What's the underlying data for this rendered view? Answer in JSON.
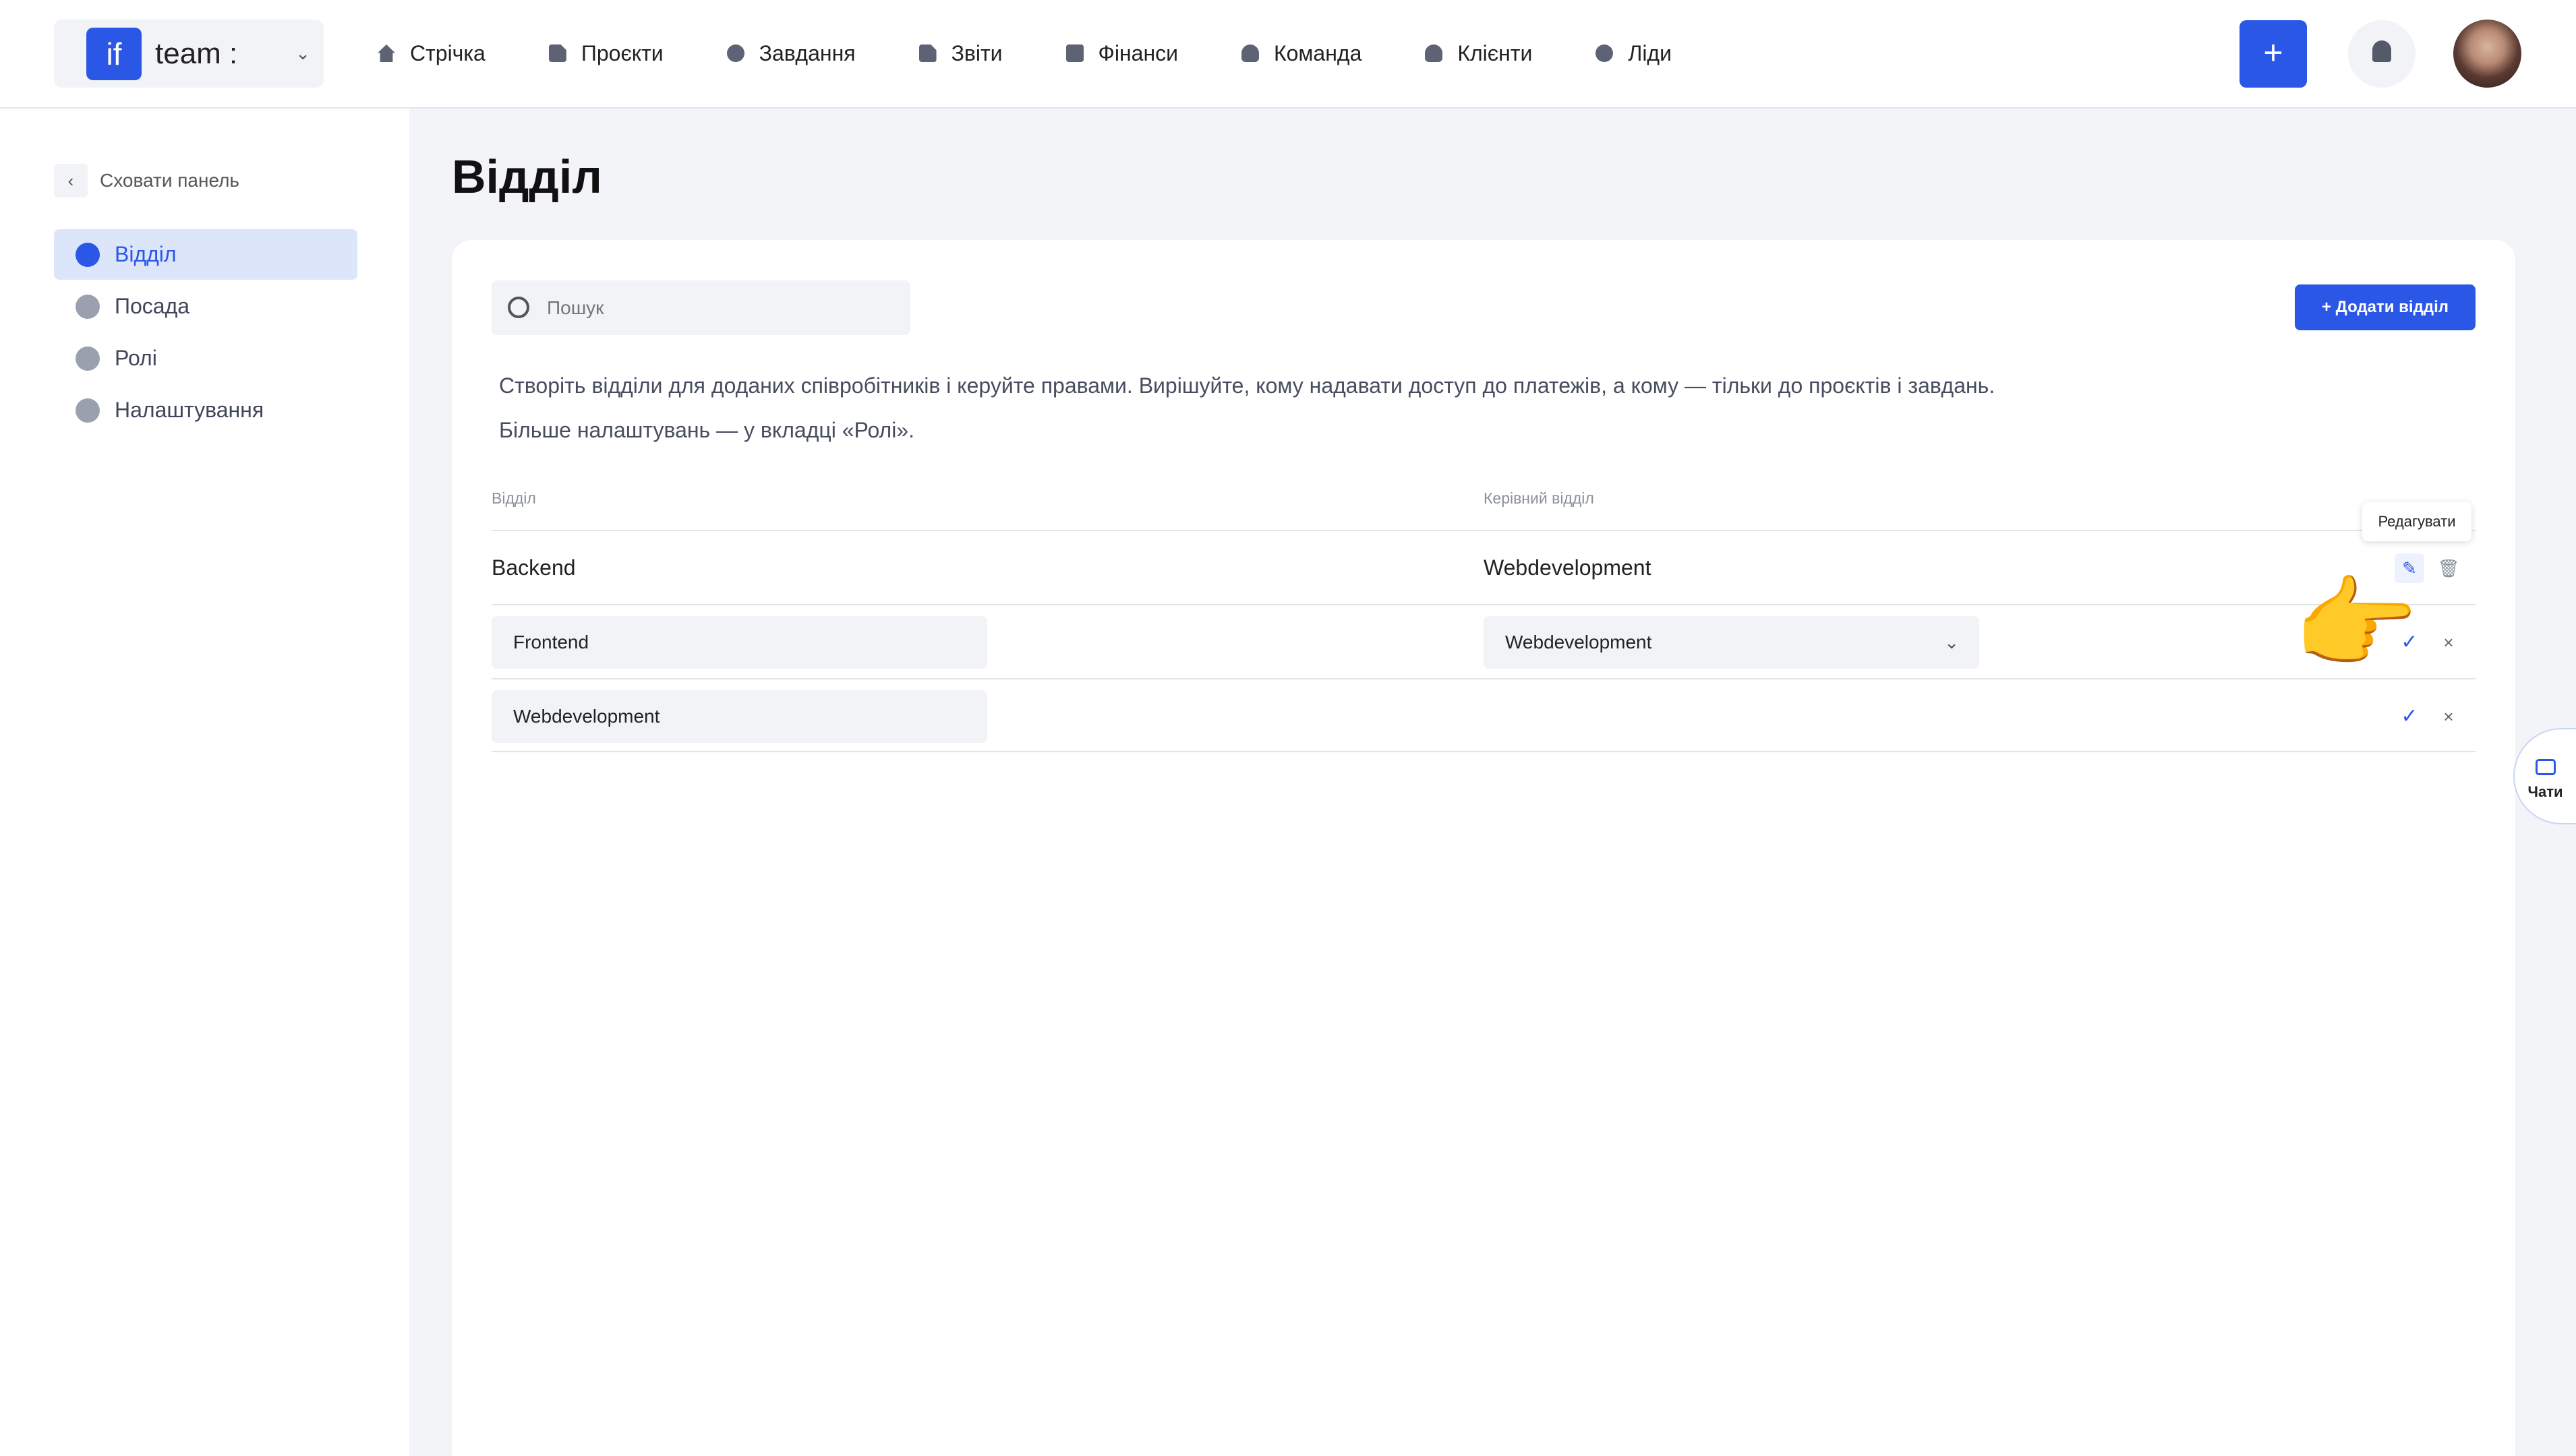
{
  "workspace": {
    "logo": "if",
    "name": "team :"
  },
  "nav": [
    {
      "label": "Стрічка",
      "icon": "home-icon"
    },
    {
      "label": "Проєкти",
      "icon": "document-icon"
    },
    {
      "label": "Завдання",
      "icon": "check-circle-icon"
    },
    {
      "label": "Звіти",
      "icon": "report-icon"
    },
    {
      "label": "Фінанси",
      "icon": "wallet-icon"
    },
    {
      "label": "Команда",
      "icon": "user-icon"
    },
    {
      "label": "Клієнти",
      "icon": "clients-icon"
    },
    {
      "label": "Ліди",
      "icon": "leads-icon"
    }
  ],
  "header": {
    "add_label": "+"
  },
  "sidebar": {
    "hide_label": "Сховати панель",
    "items": [
      {
        "label": "Відділ",
        "icon": "people-icon",
        "active": true
      },
      {
        "label": "Посада",
        "icon": "person-icon",
        "active": false
      },
      {
        "label": "Ролі",
        "icon": "key-icon",
        "active": false
      },
      {
        "label": "Налаштування",
        "icon": "gear-icon",
        "active": false
      }
    ]
  },
  "page": {
    "title": "Відділ",
    "search_placeholder": "Пошук",
    "add_button": "+ Додати відділ",
    "description_1": "Створіть відділи для доданих співробітників і керуйте правами. Вирішуйте, кому надавати доступ до платежів, а кому — тільки до проєктів і завдань.",
    "description_2": "Більше налаштувань — у вкладці «Ролі»."
  },
  "table": {
    "columns": [
      "Відділ",
      "Керівний відділ"
    ],
    "rows": [
      {
        "department": "Backend",
        "parent": "Webdevelopment",
        "mode": "view"
      },
      {
        "department": "Frontend",
        "parent": "Webdevelopment",
        "mode": "edit"
      },
      {
        "department": "Webdevelopment",
        "parent": "",
        "mode": "edit"
      }
    ]
  },
  "tooltip": "Редагувати",
  "chats_label": "Чати",
  "accent_color": "#2b57e6"
}
